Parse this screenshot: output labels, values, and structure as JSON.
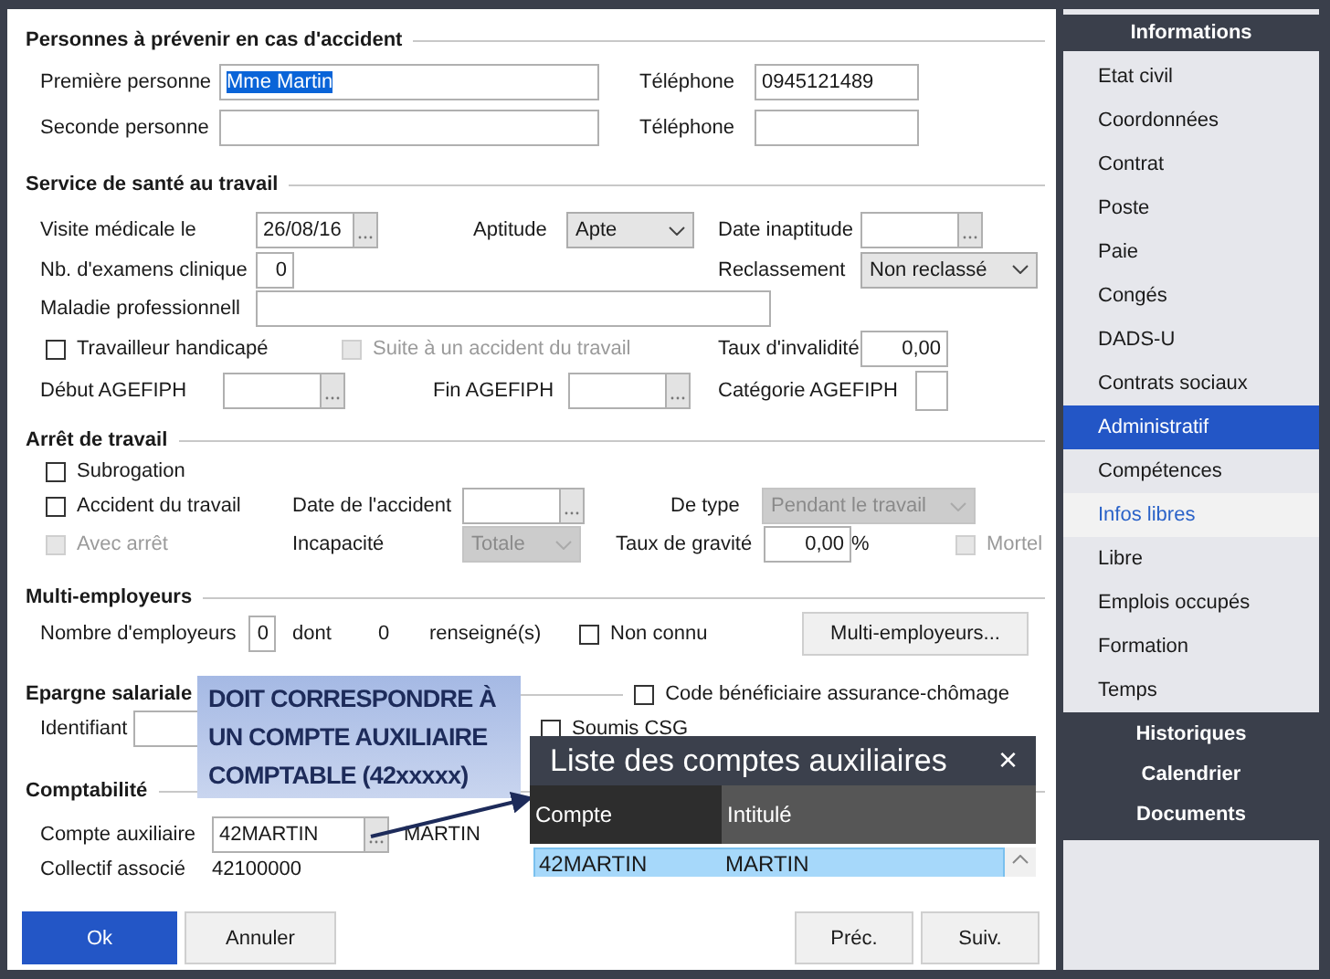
{
  "contacts": {
    "title": "Personnes à prévenir en cas d'accident",
    "rows": [
      {
        "label": "Première personne",
        "name": "Mme Martin",
        "name_text_selected": true,
        "phone_label": "Téléphone",
        "phone": "0945121489"
      },
      {
        "label": "Seconde personne",
        "phone_label": "Téléphone"
      }
    ]
  },
  "health": {
    "title": "Service de santé au travail",
    "visit_label": "Visite médicale le",
    "visit_date": "26/08/16",
    "aptitude_label": "Aptitude",
    "aptitude": {
      "value": "Apte",
      "disabled": false
    },
    "inaptitude_label": "Date inaptitude",
    "exams_label": "Nb. d'examens clinique",
    "exams": "0",
    "reclass_label": "Reclassement",
    "reclass": {
      "value": "Non reclassé",
      "disabled": false
    },
    "disease_label": "Maladie professionnell",
    "handicap": {
      "label": "Travailleur handicapé",
      "checked": false,
      "disabled": false
    },
    "following_accident": {
      "label": "Suite à un accident du travail",
      "checked": false,
      "disabled": true
    },
    "invalidity_label": "Taux d'invalidité",
    "invalidity": "0,00",
    "agefiph_start_label": "Début AGEFIPH",
    "agefiph_end_label": "Fin AGEFIPH",
    "agefiph_category_label": "Catégorie AGEFIPH"
  },
  "work_stoppage": {
    "title": "Arrêt de travail",
    "subrogation": {
      "label": "Subrogation",
      "checked": false,
      "disabled": false
    },
    "work_accident": {
      "label": "Accident du travail",
      "checked": false,
      "disabled": false
    },
    "accident_date_label": "Date de l'accident",
    "type_label": "De type",
    "type": {
      "value": "Pendant le travail",
      "disabled": true
    },
    "with_stoppage": {
      "label": "Avec arrêt",
      "checked": false,
      "disabled": true
    },
    "incapacity_label": "Incapacité",
    "incapacity": {
      "value": "Totale",
      "disabled": true
    },
    "severity_label": "Taux de gravité",
    "severity": "0,00",
    "severity_unit": "%",
    "fatal": {
      "label": "Mortel",
      "checked": false,
      "disabled": true
    }
  },
  "multi_employers": {
    "title": "Multi-employeurs",
    "count_label": "Nombre d'employeurs",
    "count": "0",
    "of_label": "dont",
    "filled": "0",
    "filled_label": "renseigné(s)",
    "unknown": {
      "label": "Non connu",
      "checked": false,
      "disabled": false
    },
    "button": "Multi-employeurs..."
  },
  "savings": {
    "title": "Epargne salariale",
    "beneficiary_code": {
      "label": "Code bénéficiaire assurance-chômage",
      "checked": false,
      "disabled": false
    },
    "id_label": "Identifiant",
    "csg": {
      "label": "Soumis CSG",
      "checked": false,
      "disabled": false
    }
  },
  "accounting": {
    "title": "Comptabilité",
    "account_label": "Compte auxiliaire",
    "account": "42MARTIN",
    "account_name": "MARTIN",
    "collective_label": "Collectif associé",
    "collective": "42100000"
  },
  "footer": {
    "left_buttons": [
      {
        "label": "Ok",
        "primary": true
      },
      {
        "label": "Annuler",
        "primary": false
      }
    ],
    "right_buttons": [
      {
        "label": "Préc.",
        "primary": false
      },
      {
        "label": "Suiv.",
        "primary": false
      }
    ]
  },
  "callout": {
    "text": "DOIT CORRESPONDRE À UN COMPTE AUXILIAIRE COMPTABLE (42xxxxx)"
  },
  "account_list": {
    "title": "Liste des comptes auxiliaires",
    "close": "×",
    "columns": [
      "Compte",
      "Intitulé"
    ],
    "rows": [
      {
        "account": "42MARTIN",
        "name": "MARTIN",
        "selected": true
      }
    ]
  },
  "sidebar": {
    "header": "Informations",
    "items": [
      {
        "label": "Etat civil",
        "selected": false,
        "hovered": false
      },
      {
        "label": "Coordonnées",
        "selected": false,
        "hovered": false
      },
      {
        "label": "Contrat",
        "selected": false,
        "hovered": false
      },
      {
        "label": "Poste",
        "selected": false,
        "hovered": false
      },
      {
        "label": "Paie",
        "selected": false,
        "hovered": false
      },
      {
        "label": "Congés",
        "selected": false,
        "hovered": false
      },
      {
        "label": "DADS-U",
        "selected": false,
        "hovered": false
      },
      {
        "label": "Contrats sociaux",
        "selected": false,
        "hovered": false
      },
      {
        "label": "Administratif",
        "selected": true,
        "hovered": false
      },
      {
        "label": "Compétences",
        "selected": false,
        "hovered": false
      },
      {
        "label": "Infos libres",
        "selected": false,
        "hovered": true
      },
      {
        "label": "Libre",
        "selected": false,
        "hovered": false
      },
      {
        "label": "Emplois occupés",
        "selected": false,
        "hovered": false
      },
      {
        "label": "Formation",
        "selected": false,
        "hovered": false
      },
      {
        "label": "Temps",
        "selected": false,
        "hovered": false
      }
    ],
    "links": [
      "Historiques",
      "Calendrier",
      "Documents"
    ]
  }
}
